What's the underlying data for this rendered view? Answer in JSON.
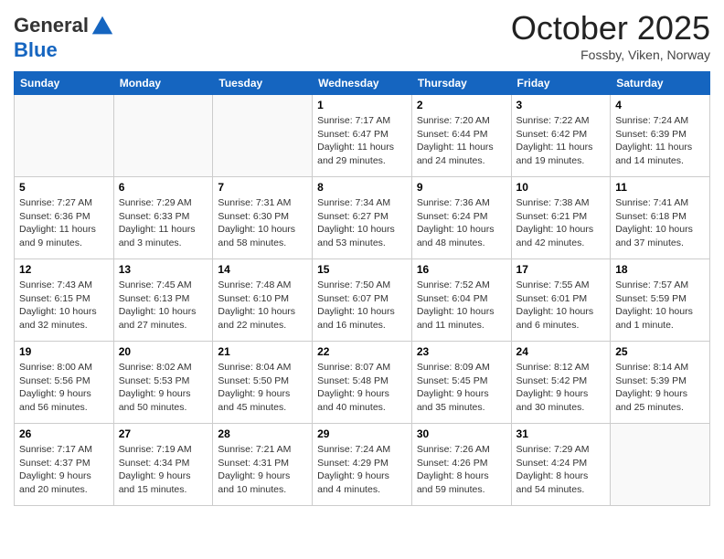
{
  "header": {
    "logo_general": "General",
    "logo_blue": "Blue",
    "month": "October 2025",
    "location": "Fossby, Viken, Norway"
  },
  "weekdays": [
    "Sunday",
    "Monday",
    "Tuesday",
    "Wednesday",
    "Thursday",
    "Friday",
    "Saturday"
  ],
  "weeks": [
    [
      {
        "day": "",
        "info": ""
      },
      {
        "day": "",
        "info": ""
      },
      {
        "day": "",
        "info": ""
      },
      {
        "day": "1",
        "info": "Sunrise: 7:17 AM\nSunset: 6:47 PM\nDaylight: 11 hours\nand 29 minutes."
      },
      {
        "day": "2",
        "info": "Sunrise: 7:20 AM\nSunset: 6:44 PM\nDaylight: 11 hours\nand 24 minutes."
      },
      {
        "day": "3",
        "info": "Sunrise: 7:22 AM\nSunset: 6:42 PM\nDaylight: 11 hours\nand 19 minutes."
      },
      {
        "day": "4",
        "info": "Sunrise: 7:24 AM\nSunset: 6:39 PM\nDaylight: 11 hours\nand 14 minutes."
      }
    ],
    [
      {
        "day": "5",
        "info": "Sunrise: 7:27 AM\nSunset: 6:36 PM\nDaylight: 11 hours\nand 9 minutes."
      },
      {
        "day": "6",
        "info": "Sunrise: 7:29 AM\nSunset: 6:33 PM\nDaylight: 11 hours\nand 3 minutes."
      },
      {
        "day": "7",
        "info": "Sunrise: 7:31 AM\nSunset: 6:30 PM\nDaylight: 10 hours\nand 58 minutes."
      },
      {
        "day": "8",
        "info": "Sunrise: 7:34 AM\nSunset: 6:27 PM\nDaylight: 10 hours\nand 53 minutes."
      },
      {
        "day": "9",
        "info": "Sunrise: 7:36 AM\nSunset: 6:24 PM\nDaylight: 10 hours\nand 48 minutes."
      },
      {
        "day": "10",
        "info": "Sunrise: 7:38 AM\nSunset: 6:21 PM\nDaylight: 10 hours\nand 42 minutes."
      },
      {
        "day": "11",
        "info": "Sunrise: 7:41 AM\nSunset: 6:18 PM\nDaylight: 10 hours\nand 37 minutes."
      }
    ],
    [
      {
        "day": "12",
        "info": "Sunrise: 7:43 AM\nSunset: 6:15 PM\nDaylight: 10 hours\nand 32 minutes."
      },
      {
        "day": "13",
        "info": "Sunrise: 7:45 AM\nSunset: 6:13 PM\nDaylight: 10 hours\nand 27 minutes."
      },
      {
        "day": "14",
        "info": "Sunrise: 7:48 AM\nSunset: 6:10 PM\nDaylight: 10 hours\nand 22 minutes."
      },
      {
        "day": "15",
        "info": "Sunrise: 7:50 AM\nSunset: 6:07 PM\nDaylight: 10 hours\nand 16 minutes."
      },
      {
        "day": "16",
        "info": "Sunrise: 7:52 AM\nSunset: 6:04 PM\nDaylight: 10 hours\nand 11 minutes."
      },
      {
        "day": "17",
        "info": "Sunrise: 7:55 AM\nSunset: 6:01 PM\nDaylight: 10 hours\nand 6 minutes."
      },
      {
        "day": "18",
        "info": "Sunrise: 7:57 AM\nSunset: 5:59 PM\nDaylight: 10 hours\nand 1 minute."
      }
    ],
    [
      {
        "day": "19",
        "info": "Sunrise: 8:00 AM\nSunset: 5:56 PM\nDaylight: 9 hours\nand 56 minutes."
      },
      {
        "day": "20",
        "info": "Sunrise: 8:02 AM\nSunset: 5:53 PM\nDaylight: 9 hours\nand 50 minutes."
      },
      {
        "day": "21",
        "info": "Sunrise: 8:04 AM\nSunset: 5:50 PM\nDaylight: 9 hours\nand 45 minutes."
      },
      {
        "day": "22",
        "info": "Sunrise: 8:07 AM\nSunset: 5:48 PM\nDaylight: 9 hours\nand 40 minutes."
      },
      {
        "day": "23",
        "info": "Sunrise: 8:09 AM\nSunset: 5:45 PM\nDaylight: 9 hours\nand 35 minutes."
      },
      {
        "day": "24",
        "info": "Sunrise: 8:12 AM\nSunset: 5:42 PM\nDaylight: 9 hours\nand 30 minutes."
      },
      {
        "day": "25",
        "info": "Sunrise: 8:14 AM\nSunset: 5:39 PM\nDaylight: 9 hours\nand 25 minutes."
      }
    ],
    [
      {
        "day": "26",
        "info": "Sunrise: 7:17 AM\nSunset: 4:37 PM\nDaylight: 9 hours\nand 20 minutes."
      },
      {
        "day": "27",
        "info": "Sunrise: 7:19 AM\nSunset: 4:34 PM\nDaylight: 9 hours\nand 15 minutes."
      },
      {
        "day": "28",
        "info": "Sunrise: 7:21 AM\nSunset: 4:31 PM\nDaylight: 9 hours\nand 10 minutes."
      },
      {
        "day": "29",
        "info": "Sunrise: 7:24 AM\nSunset: 4:29 PM\nDaylight: 9 hours\nand 4 minutes."
      },
      {
        "day": "30",
        "info": "Sunrise: 7:26 AM\nSunset: 4:26 PM\nDaylight: 8 hours\nand 59 minutes."
      },
      {
        "day": "31",
        "info": "Sunrise: 7:29 AM\nSunset: 4:24 PM\nDaylight: 8 hours\nand 54 minutes."
      },
      {
        "day": "",
        "info": ""
      }
    ]
  ]
}
